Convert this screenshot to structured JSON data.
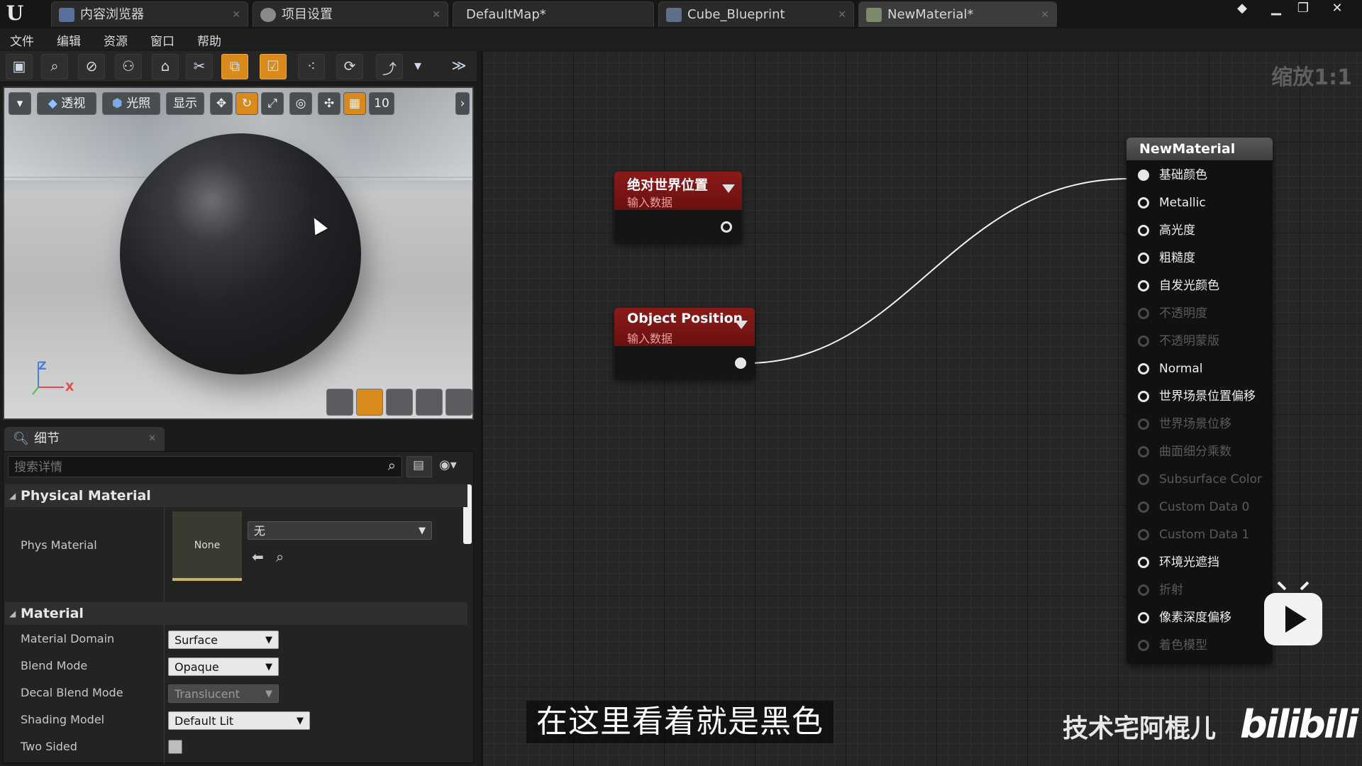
{
  "tabs": [
    {
      "label": "内容浏览器",
      "icon": "content-browser-icon"
    },
    {
      "label": "项目设置",
      "icon": "settings-icon"
    },
    {
      "label": "DefaultMap*",
      "icon": ""
    },
    {
      "label": "Cube_Blueprint",
      "icon": "blueprint-icon"
    },
    {
      "label": "NewMaterial*",
      "icon": "material-icon"
    }
  ],
  "menu": [
    "文件",
    "编辑",
    "资源",
    "窗口",
    "帮助"
  ],
  "viewport": {
    "perspective_label": "透视",
    "lit_label": "光照",
    "show_label": "显示",
    "grid_snap_value": "10",
    "axis_z": "Z",
    "axis_x": "X"
  },
  "details": {
    "tab_label": "细节",
    "search_placeholder": "搜索详情",
    "physical_material_header": "Physical Material",
    "phys_material_label": "Phys Material",
    "phys_material_thumb": "None",
    "phys_material_value": "无",
    "material_header": "Material",
    "rows": [
      {
        "label": "Material Domain",
        "value": "Surface"
      },
      {
        "label": "Blend Mode",
        "value": "Opaque"
      },
      {
        "label": "Decal Blend Mode",
        "value": "Translucent"
      },
      {
        "label": "Shading Model",
        "value": "Default Lit"
      },
      {
        "label": "Two Sided",
        "value": ""
      }
    ]
  },
  "graph": {
    "zoom_label": "缩放1:1",
    "node_absolute_world_position": {
      "title": "绝对世界位置",
      "subtitle": "输入数据"
    },
    "node_object_position": {
      "title": "Object Position",
      "subtitle": "输入数据"
    },
    "result_node": {
      "title": "NewMaterial",
      "inputs": [
        {
          "label": "基础颜色",
          "enabled": true,
          "connected": true
        },
        {
          "label": "Metallic",
          "enabled": true
        },
        {
          "label": "高光度",
          "enabled": true
        },
        {
          "label": "粗糙度",
          "enabled": true
        },
        {
          "label": "自发光颜色",
          "enabled": true
        },
        {
          "label": "不透明度",
          "enabled": false
        },
        {
          "label": "不透明蒙版",
          "enabled": false
        },
        {
          "label": "Normal",
          "enabled": true
        },
        {
          "label": "世界场景位置偏移",
          "enabled": true
        },
        {
          "label": "世界场景位移",
          "enabled": false
        },
        {
          "label": "曲面细分乘数",
          "enabled": false
        },
        {
          "label": "Subsurface Color",
          "enabled": false
        },
        {
          "label": "Custom Data 0",
          "enabled": false
        },
        {
          "label": "Custom Data 1",
          "enabled": false
        },
        {
          "label": "环境光遮挡",
          "enabled": true
        },
        {
          "label": "折射",
          "enabled": false
        },
        {
          "label": "像素深度偏移",
          "enabled": true
        },
        {
          "label": "着色模型",
          "enabled": false
        }
      ]
    }
  },
  "overlay": {
    "subtitle": "在这里看着就是黑色",
    "uploader": "技术宅阿棍儿",
    "site_logo": "bilibili"
  }
}
